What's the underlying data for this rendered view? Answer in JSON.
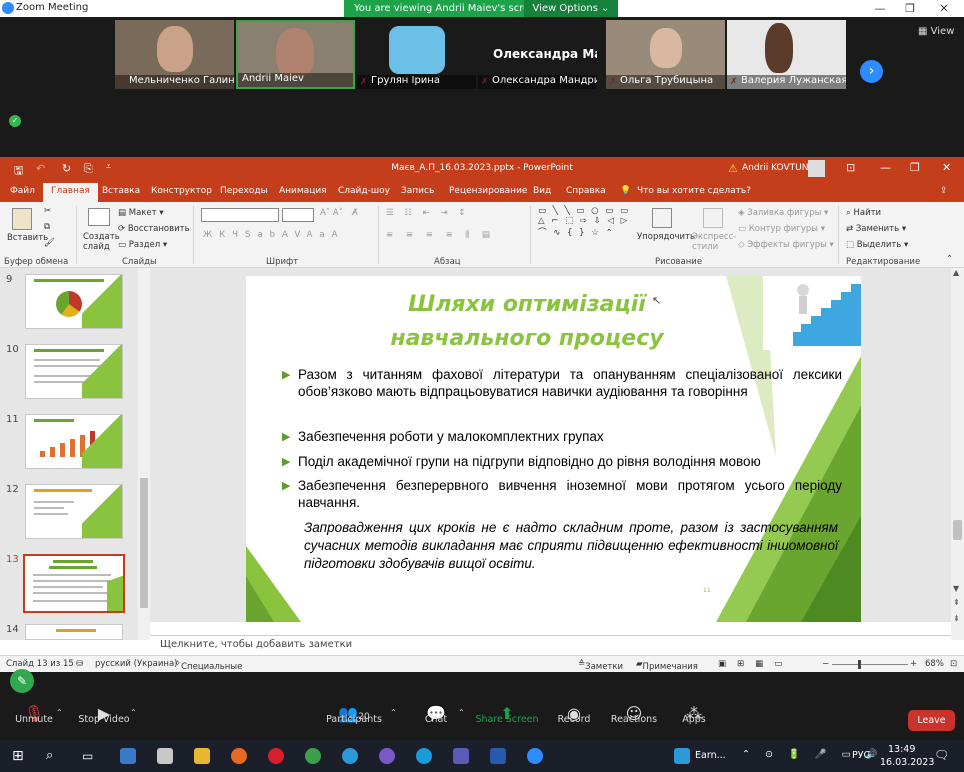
{
  "zoom": {
    "window_title": "Zoom Meeting",
    "banner_text": "You are viewing Andrii Maiev's screen",
    "view_options": "View Options",
    "view_label": "View",
    "participants_tiles": [
      {
        "name": "Мельниченко Галина",
        "muted": true
      },
      {
        "name": "Andrii Maiev",
        "muted": false
      },
      {
        "name": "Грулян Ірина",
        "muted": true
      },
      {
        "name": "Олександра Мандрик",
        "muted": true,
        "big_name": "Олександра  Ма..."
      },
      {
        "name": "Ольга Трубицына",
        "muted": true
      },
      {
        "name": "Валерия Лужанская",
        "muted": true
      }
    ],
    "toolbar": {
      "unmute": "Unmute",
      "stop_video": "Stop Video",
      "participants": "Participants",
      "participants_count": "20",
      "chat": "Chat",
      "share_screen": "Share Screen",
      "record": "Record",
      "reactions": "Reactions",
      "apps": "Apps",
      "leave": "Leave"
    },
    "colors": {
      "accent": "#2d8cff",
      "share": "#1ea34a",
      "leave": "#c9332b"
    }
  },
  "ppt": {
    "title": "Маєв_А.П_16.03.2023.pptx  -  PowerPoint",
    "warning_icon": "⚠",
    "user": "Andrii KOVTUN",
    "tabs": [
      "Файл",
      "Главная",
      "Вставка",
      "Конструктор",
      "Переходы",
      "Анимация",
      "Слайд-шоу",
      "Запись",
      "Рецензирование",
      "Вид",
      "Справка",
      "Что вы хотите сделать?"
    ],
    "ribbon": {
      "paste": "Вставить",
      "clipboard": "Буфер обмена",
      "new_slide": "Создать слайд",
      "layout": "Макет",
      "reset": "Восстановить",
      "section": "Раздел",
      "slides": "Слайды",
      "font": "Шрифт",
      "paragraph": "Абзац",
      "arrange": "Упорядочить",
      "quick_styles": "Экспресс-стили",
      "shape_fill": "Заливка фигуры",
      "shape_outline": "Контур фигуры",
      "shape_effects": "Эффекты фигуры",
      "drawing": "Рисование",
      "find": "Найти",
      "replace": "Заменить",
      "select": "Выделить",
      "editing": "Редактирование",
      "font_buttons": [
        "Ж",
        "К",
        "Ч",
        "S",
        "ab",
        "AV",
        "Aa",
        "A"
      ]
    },
    "thumbnails": [
      {
        "num": "9"
      },
      {
        "num": "10"
      },
      {
        "num": "11"
      },
      {
        "num": "12"
      },
      {
        "num": "13",
        "selected": true
      },
      {
        "num": "14"
      }
    ],
    "slide": {
      "title_line1": "Шляхи оптимізації",
      "title_line2": "навчального процесу",
      "bullets": [
        "Разом з читанням фахової літератури та опануванням спеціалізованої лексики обов’язково мають  відпрацьовуватися навички аудіювання та говоріння",
        "Забезпечення роботи у малокомплектних групах",
        "Поділ академічної групи на підгрупи відповідно до рівня володіння мовою",
        "Забезпечення безперервного вивчення іноземної мови протягом усього періоду навчання."
      ],
      "conclusion": "Запровадження цих кроків не є надто складним проте, разом із застосуванням сучасних методів викладання має сприяти підвищенню ефективності іншомовної підготовки здобувачів вищої освіти.",
      "page_number": "11",
      "accent": "#8ac43f"
    },
    "notes_placeholder": "Щелкните, чтобы добавить заметки",
    "status": {
      "slide_of": "Слайд 13 из 15",
      "language": "русский (Украина)",
      "accessibility": "Специальные возможности: проверьте рекомендации",
      "notes": "Заметки",
      "comments": "Примечания",
      "zoom": "68%"
    }
  },
  "taskbar": {
    "earn": "Earn...",
    "lang": "РУС",
    "time": "13:49",
    "date": "16.03.2023"
  }
}
